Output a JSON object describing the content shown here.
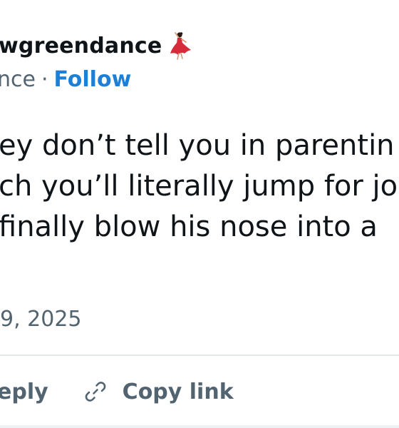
{
  "header": {
    "username": "wgreendance",
    "handle_fragment": "nce",
    "separator": "·",
    "follow_label": "Follow",
    "emoji_icon": "dancer-icon"
  },
  "tweet": {
    "lines": [
      "ey don’t tell you in parentin",
      "ch you’ll literally jump for jo",
      " finally blow his nose into a"
    ]
  },
  "timestamp": {
    "date": "9, 2025"
  },
  "actions": {
    "reply_label": "eply",
    "copy_link_label": "Copy link",
    "copy_link_icon": "link-icon"
  },
  "colors": {
    "text": "#0f1419",
    "muted": "#536471",
    "link": "#1d7fd6",
    "divider": "#e3e7ea",
    "emoji_red": "#d62b3a"
  }
}
